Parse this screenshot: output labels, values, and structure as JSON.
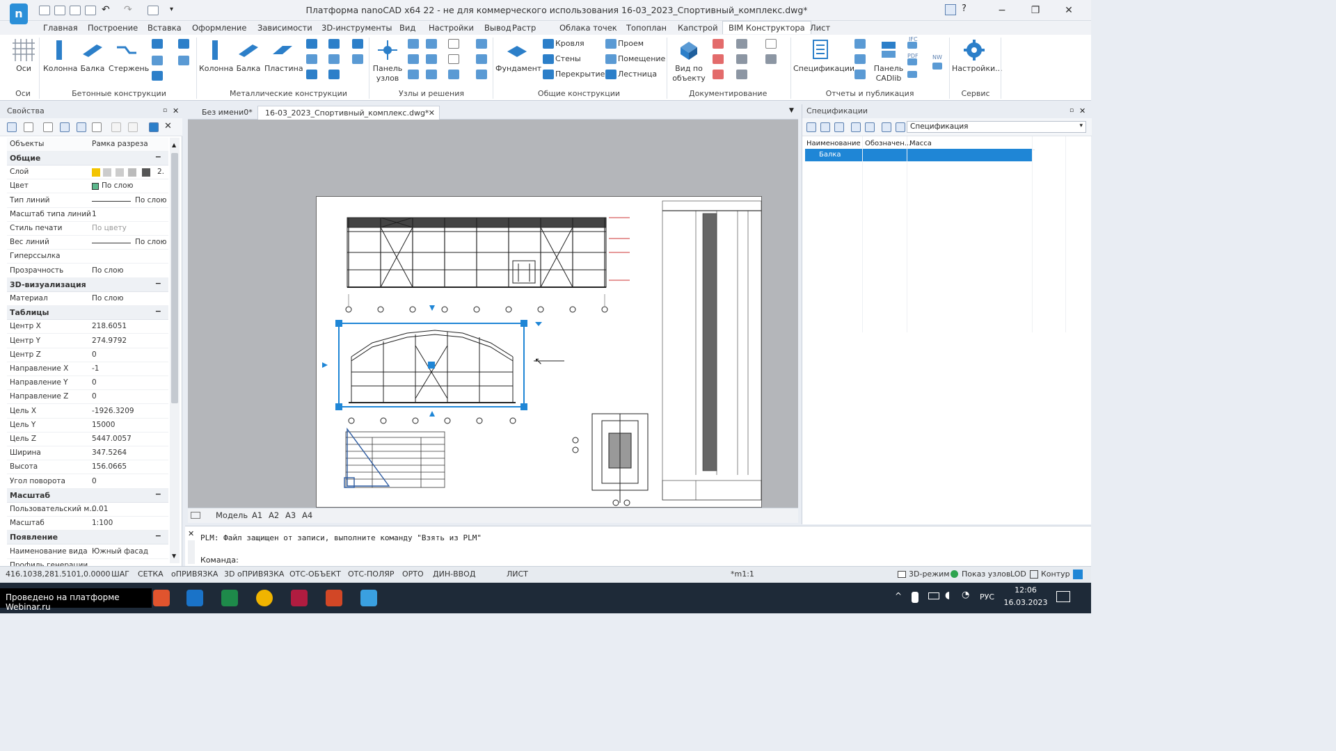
{
  "window": {
    "title": "Платформа nanoCAD x64 22 - не для коммерческого использования 16-03_2023_Спортивный_комплекс.dwg*",
    "help_label": "?"
  },
  "menu_tabs": [
    "Главная",
    "Построение",
    "Вставка",
    "Оформление",
    "Зависимости",
    "3D-инструменты",
    "Вид",
    "Настройки",
    "Вывод",
    "Растр",
    "Облака точек",
    "Топоплан",
    "Капстрой",
    "BIM Конструктора",
    "Лист"
  ],
  "active_menu_tab": "BIM Конструктора",
  "ribbon": {
    "axes_label": "Оси",
    "group_axes": "Оси",
    "column_label": "Колонна",
    "beam_label": "Балка",
    "rod_label": "Стержень",
    "group_concrete": "Бетонные конструкции",
    "metal_column_label": "Колонна",
    "metal_beam_label": "Балка",
    "plate_label": "Пластина",
    "group_metal": "Металлические конструкции",
    "node_panel_label": "Панель узлов",
    "group_nodes": "Узлы и решения",
    "foundation_label": "Фундамент",
    "roof_label": "Кровля",
    "walls_label": "Стены",
    "floors_label": "Перекрытие",
    "opening_label": "Проем",
    "room_label": "Помещение",
    "stair_label": "Лестница",
    "group_general": "Общие конструкции",
    "view_by_object_label": "Вид по объекту",
    "group_doc": "Документирование",
    "specs_label": "Спецификации",
    "cadlib_label": "Панель CADlib",
    "ifc_label": "IFC",
    "pdf_label": "PDF",
    "nw_label": "NW",
    "group_reports": "Отчеты и публикация",
    "settings_label": "Настройки...",
    "group_service": "Сервис"
  },
  "properties": {
    "header": "Свойства",
    "objects_key": "Объекты",
    "objects_value": "Рамка разреза",
    "rows": [
      {
        "type": "cat",
        "key": "Общие"
      },
      {
        "type": "row",
        "key": "Слой",
        "value": "2."
      },
      {
        "type": "row",
        "key": "Цвет",
        "value": "По слою"
      },
      {
        "type": "row",
        "key": "Тип линий",
        "value": "По слою"
      },
      {
        "type": "row",
        "key": "Масштаб типа линий",
        "value": "1"
      },
      {
        "type": "row",
        "key": "Стиль печати",
        "value": "По цвету"
      },
      {
        "type": "row",
        "key": "Вес линий",
        "value": "По слою"
      },
      {
        "type": "row",
        "key": "Гиперссылка",
        "value": ""
      },
      {
        "type": "row",
        "key": "Прозрачность",
        "value": "По слою"
      },
      {
        "type": "cat",
        "key": "3D-визуализация"
      },
      {
        "type": "row",
        "key": "Материал",
        "value": "По слою"
      },
      {
        "type": "cat",
        "key": "Таблицы"
      },
      {
        "type": "row",
        "key": "Центр X",
        "value": "218.6051"
      },
      {
        "type": "row",
        "key": "Центр Y",
        "value": "274.9792"
      },
      {
        "type": "row",
        "key": "Центр Z",
        "value": "0"
      },
      {
        "type": "row",
        "key": "Направление X",
        "value": "-1"
      },
      {
        "type": "row",
        "key": "Направление Y",
        "value": "0"
      },
      {
        "type": "row",
        "key": "Направление Z",
        "value": "0"
      },
      {
        "type": "row",
        "key": "Цель X",
        "value": "-1926.3209"
      },
      {
        "type": "row",
        "key": "Цель Y",
        "value": "15000"
      },
      {
        "type": "row",
        "key": "Цель Z",
        "value": "5447.0057"
      },
      {
        "type": "row",
        "key": "Ширина",
        "value": "347.5264"
      },
      {
        "type": "row",
        "key": "Высота",
        "value": "156.0665"
      },
      {
        "type": "row",
        "key": "Угол поворота",
        "value": "0"
      },
      {
        "type": "cat",
        "key": "Масштаб"
      },
      {
        "type": "row",
        "key": "Пользовательский м...",
        "value": "0.01"
      },
      {
        "type": "row",
        "key": "Масштаб",
        "value": "1:100"
      },
      {
        "type": "cat",
        "key": "Появление"
      },
      {
        "type": "row",
        "key": "Наименование вида",
        "value": "Южный фасад"
      },
      {
        "type": "row",
        "key": "Профиль генерации",
        "value": ""
      }
    ]
  },
  "doc_tabs": [
    "Без имени0*",
    "16-03_2023_Спортивный_комплекс.dwg*"
  ],
  "layout_tabs": [
    "Модель",
    "A1",
    "A2",
    "A3",
    "A4"
  ],
  "spec": {
    "header": "Спецификации",
    "select_value": "Спецификация",
    "columns": [
      "Наименование",
      "Обозначен...",
      "Масса"
    ],
    "selected_row": [
      "Балка",
      "",
      ""
    ]
  },
  "command": {
    "output": "PLM: Файл защищен от записи, выполните команду \"Взять из PLM\"",
    "prompt": "Команда:"
  },
  "status": {
    "coords": "416.1038,281.5101,0.0000",
    "buttons": [
      "ШАГ",
      "СЕТКА",
      "оПРИВЯЗКА",
      "3D оПРИВЯЗКА",
      "ОТС-ОБЪЕКТ",
      "ОТС-ПОЛЯР",
      "ОРТО",
      "ДИН-ВВОД"
    ],
    "sheet_label": "ЛИСТ",
    "scale_label": "*m1:1",
    "mode_3d": "3D-режим",
    "show_nodes": "Показ узлов",
    "lod_label": "LOD",
    "contour_label": "Контур"
  },
  "taskbar": {
    "watermark": "Проведено на платформе Webinar.ru",
    "lang": "РУС",
    "time": "12:06",
    "date": "16.03.2023"
  },
  "colors": {
    "accent": "#1f86d6",
    "selection": "#1f86d6"
  }
}
